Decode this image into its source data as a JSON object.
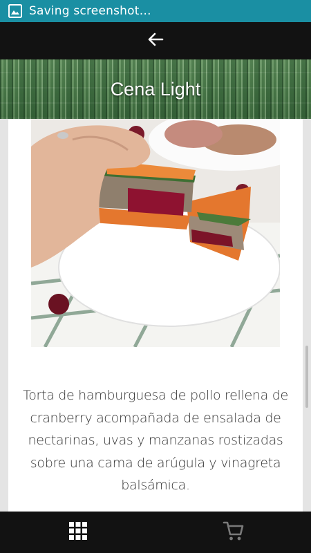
{
  "status_bar": {
    "notification_text": "Saving screenshot…",
    "icon": "image-icon",
    "background": "#1a8fa3"
  },
  "app_bar": {
    "back_icon": "arrow-left-icon",
    "background": "#121212"
  },
  "header": {
    "title": "Cena Light"
  },
  "content": {
    "description": "Torta de hamburguesa de pollo rellena de cranberry acompañada de ensalada de nectarinas, uvas y manzanas rostizadas sobre una cama de arúgula y vinagreta balsámica."
  },
  "bottom_nav": {
    "items": [
      {
        "icon": "grid-icon",
        "color": "#ffffff"
      },
      {
        "icon": "shopping-cart-icon",
        "color": "#7a7a7a"
      }
    ]
  }
}
